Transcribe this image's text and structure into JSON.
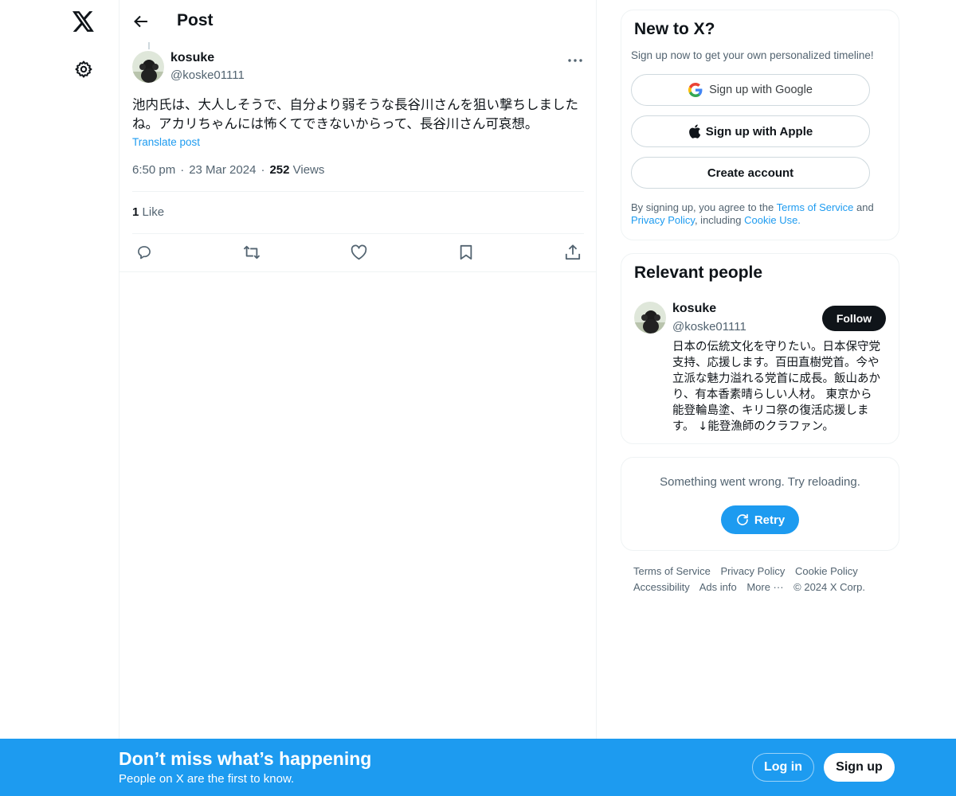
{
  "icons": {
    "logo": "x-logo-icon",
    "settings": "gear-icon",
    "back": "arrow-left-icon",
    "more": "more-dots-icon",
    "reply": "reply-icon",
    "repost": "repost-icon",
    "like": "heart-icon",
    "bookmark": "bookmark-icon",
    "share": "share-icon",
    "google": "google-icon",
    "apple": "apple-icon",
    "retry": "refresh-icon"
  },
  "colors": {
    "accent": "#1d9bf0",
    "text": "#0f1419",
    "muted": "#536471",
    "border": "#eff3f4"
  },
  "header": {
    "title": "Post"
  },
  "post": {
    "author_name": "kosuke",
    "author_handle": "@koske01111",
    "text": "池内氏は、大人しそうで、自分より弱そうな長谷川さんを狙い撃ちしましたね。アカリちゃんには怖くてできないからって、長谷川さん可哀想。",
    "translate_label": "Translate post",
    "time": "6:50 pm",
    "date": "23 Mar 2024",
    "views_count": "252",
    "views_label": "Views",
    "likes_count": "1",
    "likes_label": "Like"
  },
  "signup_card": {
    "title": "New to X?",
    "subtitle": "Sign up now to get your own personalized timeline!",
    "google_label": "Sign up with Google",
    "apple_label": "Sign up with Apple",
    "create_label": "Create account",
    "legal_prefix": "By signing up, you agree to the ",
    "terms_link": "Terms of Service",
    "legal_and": " and ",
    "privacy_link": "Privacy Policy",
    "legal_including": ", including ",
    "cookie_link": "Cookie Use."
  },
  "relevant": {
    "title": "Relevant people",
    "name": "kosuke",
    "handle": "@koske01111",
    "follow_label": "Follow",
    "bio": "日本の伝統文化を守りたい。日本保守党支持、応援します。百田直樹党首。今や立派な魅力溢れる党首に成長。飯山あかり、有本香素晴らしい人材。 東京から能登輪島塗、キリコ祭の復活応援します。 ↓能登漁師のクラファン。"
  },
  "trends_error": {
    "message": "Something went wrong. Try reloading.",
    "retry_label": "Retry"
  },
  "footer": {
    "links": [
      "Terms of Service",
      "Privacy Policy",
      "Cookie Policy",
      "Accessibility",
      "Ads info",
      "More ···",
      "© 2024 X Corp."
    ]
  },
  "bottom_bar": {
    "title": "Don’t miss what’s happening",
    "subtitle": "People on X are the first to know.",
    "login_label": "Log in",
    "signup_label": "Sign up"
  }
}
